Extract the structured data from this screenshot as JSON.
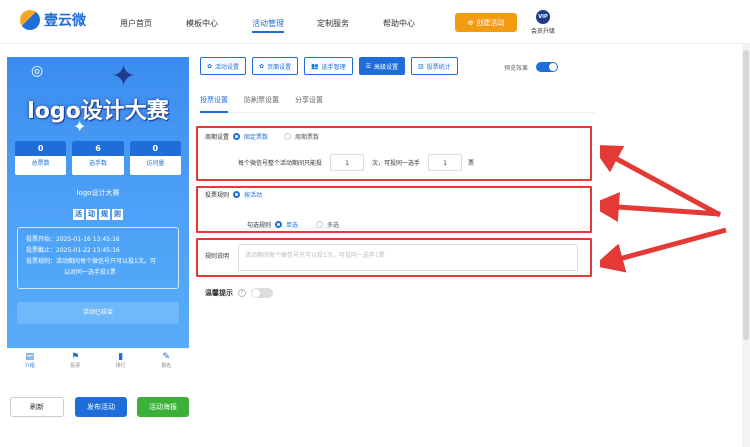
{
  "brand": {
    "name": "壹云微"
  },
  "nav": [
    {
      "label": "用户首页",
      "active": false
    },
    {
      "label": "模板中心",
      "active": false
    },
    {
      "label": "活动管理",
      "active": true
    },
    {
      "label": "定制服务",
      "active": false
    },
    {
      "label": "帮助中心",
      "active": false
    }
  ],
  "create_button": "创建活动",
  "vip": {
    "badge": "VIP",
    "label": "会员升级"
  },
  "preview": {
    "banner_title": "logo设计大赛",
    "stats": [
      {
        "value": "0",
        "label": "总票数"
      },
      {
        "value": "6",
        "label": "选手数"
      },
      {
        "value": "0",
        "label": "访问量"
      }
    ],
    "activity_name": "logo设计大赛",
    "rules_title_chars": [
      "活",
      "动",
      "规",
      "则"
    ],
    "rules": [
      "投票开始：2025-01-16 13:45:16",
      "投票截止：2025-01-22 13:45:16",
      "投票规则：活动期间每个微信号只可以投1次。可",
      "以对同一选手投1票"
    ],
    "ended_text": "活动已结束",
    "tabbar": [
      {
        "icon": "▤",
        "label": "介绍",
        "active": true
      },
      {
        "icon": "⚑",
        "label": "投票",
        "active": false
      },
      {
        "icon": "▮",
        "label": "排行",
        "active": false
      },
      {
        "icon": "✎",
        "label": "报名",
        "active": false
      }
    ]
  },
  "actions": {
    "refresh": "刷新",
    "publish": "发布活动",
    "poster": "活动海报"
  },
  "toolbar": [
    {
      "icon": "✿",
      "label": "活动设置",
      "active": false
    },
    {
      "icon": "✿",
      "label": "页面设置",
      "active": false
    },
    {
      "icon": "👥",
      "label": "选手管理",
      "active": false
    },
    {
      "icon": "☰",
      "label": "高级设置",
      "active": true
    },
    {
      "icon": "▥",
      "label": "投票统计",
      "active": false
    }
  ],
  "preview_toggle": {
    "label": "预览效果",
    "on": true
  },
  "subtabs": [
    {
      "label": "投票设置",
      "active": true
    },
    {
      "label": "防刷票设置",
      "active": false
    },
    {
      "label": "分享设置",
      "active": false
    }
  ],
  "period": {
    "label": "周期设置",
    "options": [
      {
        "label": "固定票数",
        "selected": true
      },
      {
        "label": "周期票数",
        "selected": false
      }
    ],
    "line_prefix": "每个微信号整个活动期间只能投",
    "votes": "1",
    "middle": "次，可投同一选手",
    "same_player": "1",
    "suffix": "票"
  },
  "vote_rule": {
    "label": "投票规则",
    "option": "按活动",
    "check_label": "勾选规则",
    "choices": [
      {
        "label": "单选",
        "selected": true
      },
      {
        "label": "多选",
        "selected": false
      }
    ]
  },
  "rule_desc": {
    "label": "规则说明",
    "placeholder": "活动期间每个微信号只可以投1次，可投同一选手1票"
  },
  "tip": {
    "label": "温馨提示",
    "help": "?",
    "on": false
  }
}
